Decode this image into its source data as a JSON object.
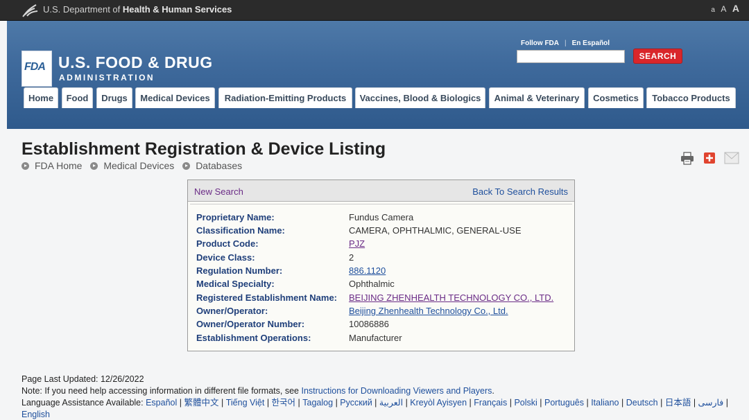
{
  "hhs_bar": {
    "text_prefix": "U.S. Department of",
    "text_bold": "Health & Human Services",
    "text_size_small": "a",
    "text_size_medium": "A",
    "text_size_large": "A"
  },
  "header": {
    "logo_text": "FDA",
    "title": "U.S. FOOD & DRUG",
    "subtitle": "ADMINISTRATION",
    "follow_label": "Follow FDA",
    "follow_separator": "|",
    "espanol_label": "En Español",
    "search_value": "",
    "search_button": "SEARCH"
  },
  "nav": {
    "tabs": [
      {
        "label": "Home"
      },
      {
        "label": "Food"
      },
      {
        "label": "Drugs"
      },
      {
        "label": "Medical Devices"
      },
      {
        "label": "Radiation-Emitting Products"
      },
      {
        "label": "Vaccines, Blood & Biologics"
      },
      {
        "label": "Animal & Veterinary"
      },
      {
        "label": "Cosmetics"
      },
      {
        "label": "Tobacco Products"
      }
    ]
  },
  "page": {
    "title": "Establishment Registration & Device Listing",
    "breadcrumb": [
      "FDA Home",
      "Medical Devices",
      "Databases"
    ],
    "tools": [
      "print-icon",
      "bookmark-icon",
      "email-icon"
    ]
  },
  "result": {
    "new_search": "New Search",
    "back_to_results": "Back To Search Results",
    "rows": [
      {
        "label": "Proprietary Name:",
        "value": "Fundus Camera",
        "style": "plain"
      },
      {
        "label": "Classification Name:",
        "value": "CAMERA, OPHTHALMIC, GENERAL-USE",
        "style": "plain"
      },
      {
        "label": "Product Code:",
        "value": "PJZ",
        "style": "visited"
      },
      {
        "label": "Device Class:",
        "value": "2",
        "style": "plain"
      },
      {
        "label": "Regulation Number:",
        "value": "886.1120",
        "style": "link"
      },
      {
        "label": "Medical Specialty:",
        "value": "Ophthalmic",
        "style": "plain"
      },
      {
        "label": "Registered Establishment Name:",
        "value": "BEIJING ZHENHEALTH TECHNOLOGY CO., LTD.",
        "style": "visited"
      },
      {
        "label": "Owner/Operator:",
        "value": "Beijing Zhenhealth Technology Co., Ltd.",
        "style": "link"
      },
      {
        "label": "Owner/Operator Number:",
        "value": "10086886",
        "style": "plain"
      },
      {
        "label": "Establishment Operations:",
        "value": "Manufacturer",
        "style": "plain"
      }
    ]
  },
  "footer": {
    "last_updated": "Page Last Updated: 12/26/2022",
    "note_prefix": "Note: If you need help accessing information in different file formats, see",
    "note_link": "Instructions for Downloading Viewers and Players",
    "note_suffix": ".",
    "language_prefix": "Language Assistance Available:",
    "languages": [
      "Español",
      "繁體中文",
      "Tiếng Việt",
      "한국어",
      "Tagalog",
      "Русский",
      "العربية",
      "Kreyòl Ayisyen",
      "Français",
      "Polski",
      "Português",
      "Italiano",
      "Deutsch",
      "日本語",
      "فارسی",
      "English"
    ],
    "separator": "|"
  }
}
